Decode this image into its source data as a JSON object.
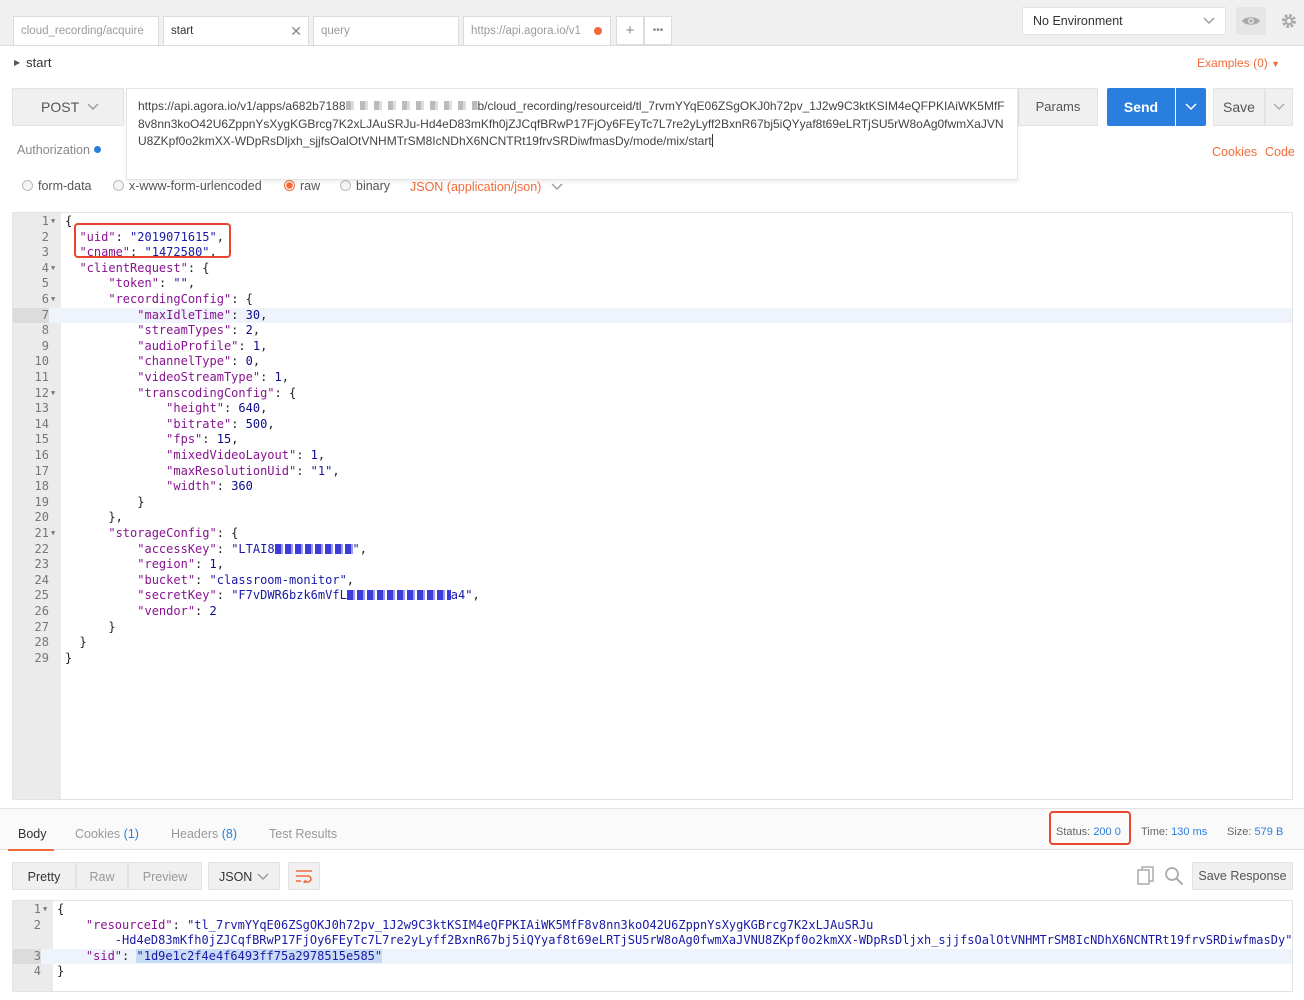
{
  "tabs": [
    {
      "label": "cloud_recording/acquire"
    },
    {
      "label": "start"
    },
    {
      "label": "query"
    },
    {
      "label": "https://api.agora.io/v1"
    }
  ],
  "tab_close": "✕",
  "tab_add": "+",
  "tab_more": "•••",
  "environment": {
    "selected": "No Environment"
  },
  "request": {
    "name": "start",
    "examples": "Examples (0)",
    "method": "POST",
    "url_parts": [
      "https://api.agora.io/v1/apps/a682b7188",
      "b/cloud_recording/resourceid/tl_7rvmYYqE06ZSgOKJ0h72pv_1J2w9C3ktKSIM4eQFPKIAiWK5MfF8v8nn3koO42U6ZppnYsXygKGBrcg7K2xLJAuSRJu-Hd4eD83mKfh0jZJCqfBRwP17FjOy6FEyTc7L7re2yLyff2BxnR67bj5iQYyaf8t69eLRTjSU5rW8oAg0fwmXaJVNU8ZKpf0o2kmXX-WDpRsDljxh_sjjfsOalOtVNHMTrSM8IcNDhX6NCNTRt19frvSRDiwfmasDy/mode/mix/start"
    ],
    "params_label": "Params",
    "send_label": "Send",
    "save_label": "Save",
    "authorization_label": "Authorization",
    "cookies_label": "Cookies",
    "code_label": "Code"
  },
  "body_options": {
    "form_data": "form-data",
    "urlencoded": "x-www-form-urlencoded",
    "raw": "raw",
    "binary": "binary",
    "content_type": "JSON (application/json)",
    "selected": "raw"
  },
  "request_body": {
    "line_numbers": [
      "1",
      "2",
      "3",
      "4",
      "5",
      "6",
      "7",
      "8",
      "9",
      "10",
      "11",
      "12",
      "13",
      "14",
      "15",
      "16",
      "17",
      "18",
      "19",
      "20",
      "21",
      "22",
      "23",
      "24",
      "25",
      "26",
      "27",
      "28",
      "29"
    ],
    "uid": "2019071615",
    "cname": "1472580",
    "token": "",
    "maxIdleTime": "30",
    "streamTypes": "2",
    "audioProfile": "1",
    "channelType": "0",
    "videoStreamType": "1",
    "height": "640",
    "bitrate": "500",
    "fps": "15",
    "mixedVideoLayout": "1",
    "maxResolutionUid": "1",
    "width": "360",
    "accessKey_visible": "LTAI8",
    "region": "1",
    "bucket": "classroom-monitor",
    "secretKey_visible_start": "F7vDWR6bzk6mVfL",
    "secretKey_visible_end": "a4",
    "vendor": "2"
  },
  "response": {
    "tabs": {
      "body": "Body",
      "cookies": "Cookies",
      "cookies_count": "(1)",
      "headers": "Headers",
      "headers_count": "(8)",
      "test_results": "Test Results"
    },
    "status_label": "Status:",
    "status_value": "200 0",
    "time_label": "Time:",
    "time_value": "130 ms",
    "size_label": "Size:",
    "size_value": "579 B",
    "view_modes": {
      "pretty": "Pretty",
      "raw": "Raw",
      "preview": "Preview"
    },
    "format": "JSON",
    "save_response": "Save Response",
    "line_numbers": [
      "1",
      "2",
      "3",
      "4"
    ],
    "resourceId_line1": "tl_7rvmYYqE06ZSgOKJ0h72pv_1J2w9C3ktKSIM4eQFPKIAiWK5MfF8v8nn3koO42U6ZppnYsXygKGBrcg7K2xLJAuSRJu",
    "resourceId_line2": "-Hd4eD83mKfh0jZJCqfBRwP17FjOy6FEyTc7L7re2yLyff2BxnR67bj5iQYyaf8t69eLRTjSU5rW8oAg0fwmXaJVNU8ZKpf0o2kmXX-WDpRsDljxh_sjjfsOalOtVNHMTrSM8IcNDhX6NCNTRt19frvSRDiwfmasDy",
    "sid": "1d9e1c2f4e4f6493ff75a2978515e585"
  },
  "colors": {
    "accent": "#f26b3a",
    "primary": "#2a7ede",
    "highlight_box": "#e8472e"
  }
}
